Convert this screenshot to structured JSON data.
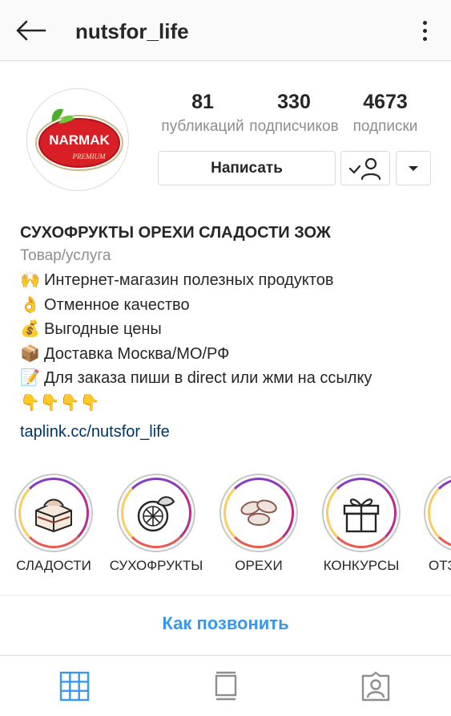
{
  "header": {
    "username": "nutsfor_life",
    "back_icon": "arrow-left-icon",
    "more_icon": "more-vertical-icon"
  },
  "profile": {
    "avatar_text": "NARMAK",
    "avatar_subtext": "PREMIUM",
    "stats": [
      {
        "value": "81",
        "label": "публикаций"
      },
      {
        "value": "330",
        "label": "подписчиков"
      },
      {
        "value": "4673",
        "label": "подписки"
      }
    ],
    "message_button": "Написать",
    "following_icon": "person-check-icon",
    "dropdown_icon": "caret-down-icon"
  },
  "bio": {
    "name": "СУХОФРУКТЫ ОРЕХИ СЛАДОСТИ ЗОЖ",
    "category": "Товар/услуга",
    "lines": [
      {
        "emoji": "🙌",
        "text": "Интернет-магазин полезных продуктов"
      },
      {
        "emoji": "👌",
        "text": "Отменное качество"
      },
      {
        "emoji": "💰",
        "text": "Выгодные цены"
      },
      {
        "emoji": "📦",
        "text": "Доставка Москва/МО/РФ"
      },
      {
        "emoji": "📝",
        "text": "Для заказа пиши в direct или жми на ссылку"
      },
      {
        "emoji": "",
        "text": "👇👇👇👇"
      }
    ],
    "link": "taplink.cc/nutsfor_life"
  },
  "highlights": [
    {
      "label": "СЛАДОСТИ",
      "icon": "cake-icon"
    },
    {
      "label": "СУХОФРУКТЫ",
      "icon": "citrus-icon"
    },
    {
      "label": "ОРЕХИ",
      "icon": "nuts-icon"
    },
    {
      "label": "КОНКУРСЫ",
      "icon": "gift-icon"
    },
    {
      "label": "ОТЗЫВЫ",
      "icon": "highlight-icon"
    }
  ],
  "call_button": "Как позвонить",
  "tabs": [
    {
      "icon": "grid-icon",
      "active": true
    },
    {
      "icon": "feed-icon",
      "active": false
    },
    {
      "icon": "tagged-icon",
      "active": false
    }
  ],
  "colors": {
    "link": "#003569",
    "accent": "#3897f0",
    "muted": "#8e8e8e",
    "text": "#262626",
    "brand_red": "#d81f26",
    "brand_green": "#4caf2a"
  }
}
